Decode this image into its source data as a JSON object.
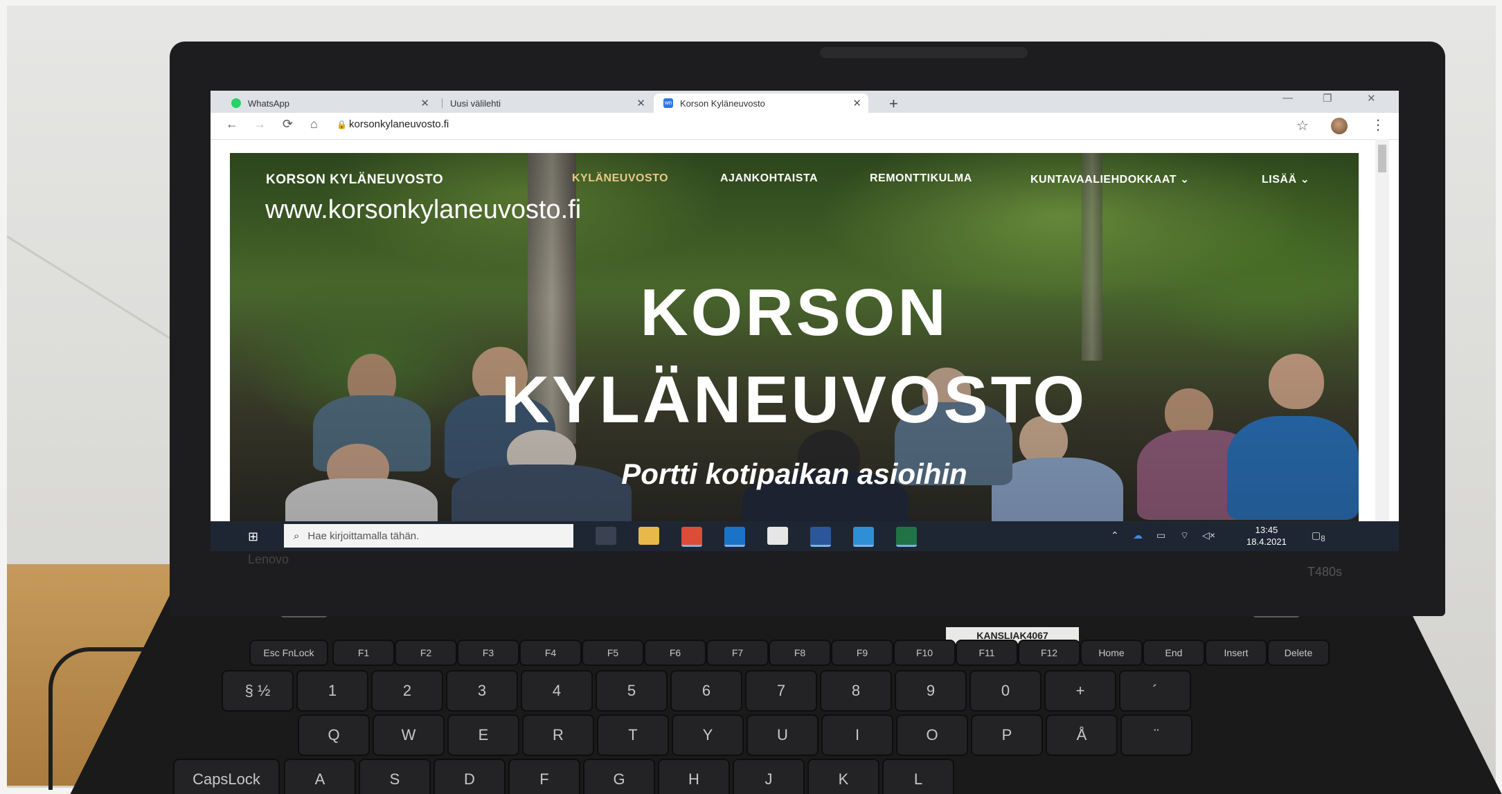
{
  "browser": {
    "tabs": [
      {
        "label": "WhatsApp",
        "favicon_color": "#25d366",
        "active": false
      },
      {
        "label": "Uusi välilehti",
        "favicon_color": "#dee1e6",
        "active": false
      },
      {
        "label": "Korson Kyläneuvosto",
        "favicon_color": "#2c7be5",
        "favicon_text": "wn",
        "active": true
      }
    ],
    "new_tab_glyph": "+",
    "close_glyph": "✕",
    "address": "korsonkylaneuvosto.fi",
    "nav_icons": [
      "back-icon",
      "forward-icon",
      "reload-icon",
      "home-icon"
    ],
    "nav_glyphs": {
      "back": "←",
      "forward": "→",
      "reload": "⟳",
      "home": "⌂"
    },
    "star_glyph": "☆",
    "menu_glyph": "⋮",
    "window_controls": {
      "minimize": "—",
      "restore": "❐",
      "close": "✕"
    }
  },
  "site": {
    "logo": "KORSON KYLÄNEUVOSTO",
    "nav": [
      {
        "label": "KYLÄNEUVOSTO",
        "active": true
      },
      {
        "label": "AJANKOHTAISTA",
        "active": false
      },
      {
        "label": "REMONTTIKULMA",
        "active": false
      },
      {
        "label": "KUNTAVAALIEHDOKKAAT ⌄",
        "active": false
      },
      {
        "label": "LISÄÄ ⌄",
        "active": false
      }
    ],
    "hero_line1": "KORSON",
    "hero_line2": "KYLÄNEUVOSTO",
    "hero_subtitle": "Portti kotipaikan asioihin",
    "accent_color": "#e9c98a"
  },
  "overlay": {
    "url_text": "www.korsonkylaneuvosto.fi"
  },
  "taskbar": {
    "start_glyph": "⊞",
    "search_placeholder": "Hae kirjoittamalla tähän.",
    "search_glyph": "⌕",
    "apps": [
      {
        "name": "task-view-icon",
        "color": "#3a4150",
        "active": false
      },
      {
        "name": "file-explorer-icon",
        "color": "#e8b84a",
        "active": false
      },
      {
        "name": "chrome-icon",
        "color": "#dd4b39",
        "active": true
      },
      {
        "name": "outlook-icon",
        "color": "#1a73c7",
        "active": true
      },
      {
        "name": "mail-icon",
        "color": "#e6e6e6",
        "active": false
      },
      {
        "name": "word-icon",
        "color": "#2b579a",
        "active": true
      },
      {
        "name": "photos-icon",
        "color": "#2f8fd6",
        "active": true
      },
      {
        "name": "excel-icon",
        "color": "#217346",
        "active": true
      }
    ],
    "tray_glyphs": [
      "⌃",
      "☁",
      "▭",
      "⌔",
      "◁×"
    ],
    "time": "13:45",
    "date": "18.4.2021",
    "notification_count": "8"
  },
  "laptop": {
    "brand": "Lenovo",
    "model": "T480s",
    "asset_tag": "KANSLIAK4067",
    "fn_keys": [
      "Esc FnLock",
      "F1",
      "F2",
      "F3",
      "F4",
      "F5",
      "F6",
      "F7",
      "F8",
      "F9",
      "F10",
      "F11",
      "F12",
      "Home",
      "End",
      "Insert",
      "Delete"
    ],
    "number_row": [
      "§ ½",
      "1",
      "2",
      "3",
      "4",
      "5",
      "6",
      "7",
      "8",
      "9",
      "0",
      "+",
      "´"
    ],
    "qwerty_row": [
      "Q",
      "W",
      "E",
      "R",
      "T",
      "Y",
      "U",
      "I",
      "O",
      "P",
      "Å",
      "¨"
    ],
    "asdf_row": [
      "CapsLock",
      "A",
      "S",
      "D",
      "F",
      "G",
      "H",
      "J",
      "K",
      "L"
    ]
  }
}
